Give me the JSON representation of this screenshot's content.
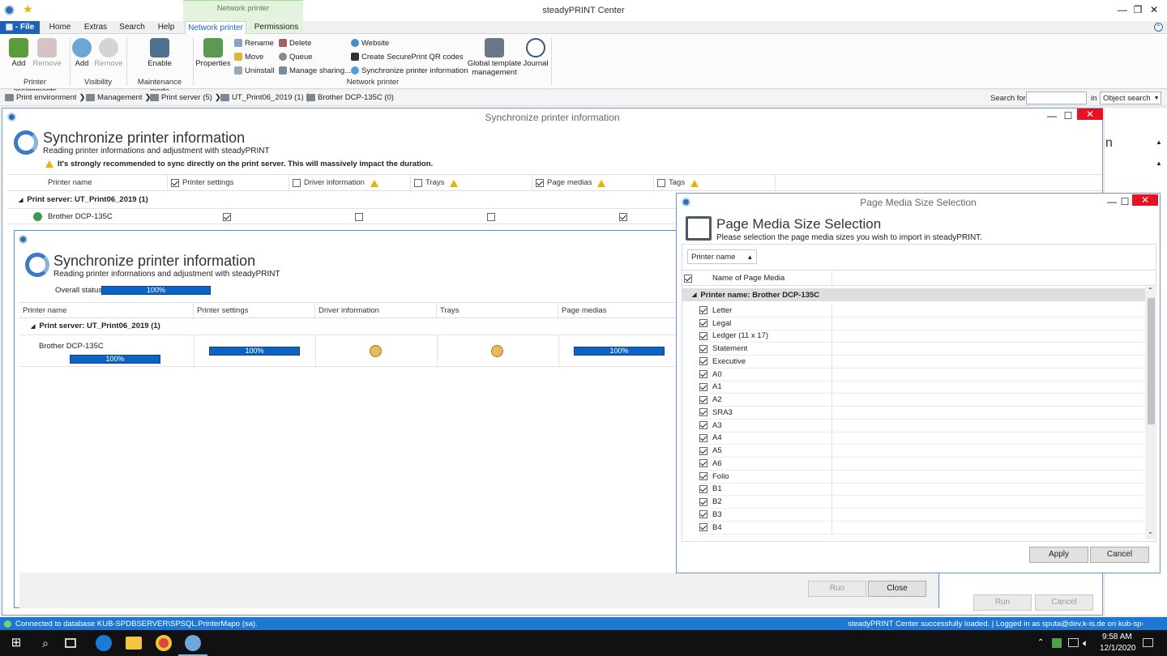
{
  "window": {
    "title": "steadyPRINT Center"
  },
  "context_tab_group": "Network printer",
  "tabs": [
    "File",
    "Home",
    "Extras",
    "Search",
    "Help",
    "Network printer",
    "Permissions"
  ],
  "ribbon": {
    "printer_assignments": {
      "add": "Add",
      "remove": "Remove",
      "group": "Printer assignments"
    },
    "visibility": {
      "add": "Add",
      "remove": "Remove",
      "group": "Visibility"
    },
    "maintenance": {
      "enable": "Enable",
      "group": "Maintenance mode"
    },
    "network_printer": {
      "properties": "Properties",
      "rename": "Rename",
      "move": "Move",
      "uninstall": "Uninstall",
      "delete": "Delete",
      "queue": "Queue",
      "manage_sharing": "Manage sharing...",
      "website": "Website",
      "qr": "Create SecurePrint QR codes",
      "sync": "Synchronize printer information",
      "global_template": "Global template management",
      "journal": "Journal",
      "group": "Network printer"
    }
  },
  "breadcrumb": [
    "Print environment",
    "Management",
    "Print server (5)",
    "UT_Print06_2019 (1)",
    "Brother DCP-135C (0)"
  ],
  "search": {
    "label": "Search for",
    "value": "",
    "in_label": "in",
    "scope": "Object search"
  },
  "bg_dialog": {
    "title": "Synchronize printer information",
    "heading": "Synchronize printer information",
    "subheading": "Reading printer informations and adjustment with steadyPRINT",
    "warning": "It's strongly recommended to sync directly on the print server. This will massively impact the duration.",
    "columns": [
      "Printer name",
      "Printer settings",
      "Driver information",
      "Trays",
      "Page medias",
      "Tags"
    ],
    "column_checked": [
      true,
      false,
      false,
      true,
      false
    ],
    "group": "Print server: UT_Print06_2019 (1)",
    "row": {
      "name": "Brother DCP-135C",
      "settings": true,
      "driver": false,
      "trays": false,
      "medias": true
    },
    "run": "Run",
    "cancel": "Cancel"
  },
  "progress_dialog": {
    "heading": "Synchronize printer information",
    "subheading": "Reading printer informations and adjustment with steadyPRINT",
    "overall_label": "Overall status",
    "overall_value": "100%",
    "columns": [
      "Printer name",
      "Printer settings",
      "Driver information",
      "Trays",
      "Page medias"
    ],
    "group": "Print server: UT_Print06_2019 (1)",
    "row": {
      "name": "Brother DCP-135C",
      "name_progress": "100%",
      "settings_progress": "100%",
      "medias_progress": "100%"
    },
    "run": "Run",
    "close": "Close"
  },
  "pm_dialog": {
    "title": "Page Media Size Selection",
    "heading": "Page Media Size Selection",
    "subheading": "Please selection the page media sizes you wish to import in steadyPRINT.",
    "group_by": "Printer name",
    "column": "Name of Page Media",
    "group": "Printer name: Brother DCP-135C",
    "items": [
      "Letter",
      "Legal",
      "Ledger (11 x 17)",
      "Statement",
      "Executive",
      "A0",
      "A1",
      "A2",
      "SRA3",
      "A3",
      "A4",
      "A5",
      "A6",
      "Folio",
      "B1",
      "B2",
      "B3",
      "B4"
    ],
    "apply": "Apply",
    "cancel": "Cancel"
  },
  "partial_right_text": "n",
  "status_bar": {
    "left": "Connected to database KUB-SPDBSERVER\\SPSQL.PrinterMapo (sa).",
    "right": "steadyPRINT Center successfully loaded. | Logged in as sputa@dev.k-is.de on kub-sp-ss.dev.k-is.de"
  },
  "clock": {
    "time": "9:58 AM",
    "date": "12/1/2020"
  },
  "colors": {
    "accent": "#1e77d2",
    "file_tab": "#1e62b8",
    "progress": "#0a64c8",
    "close_red": "#e81123"
  }
}
